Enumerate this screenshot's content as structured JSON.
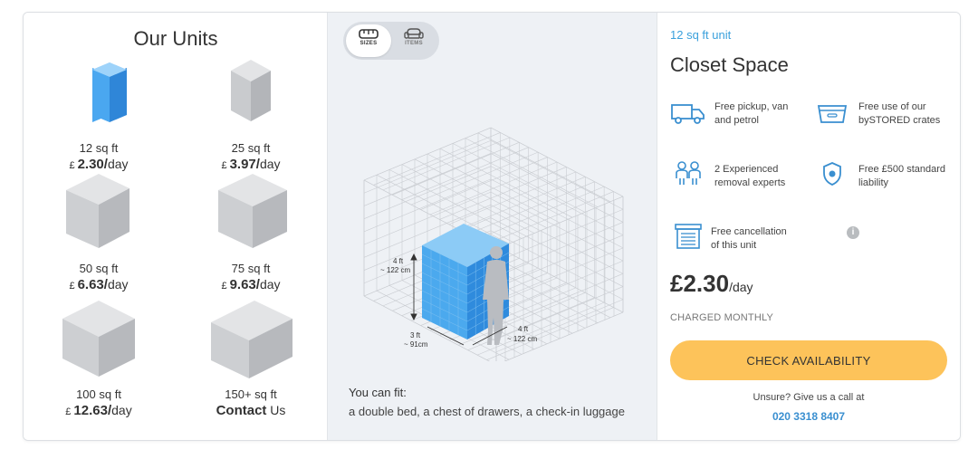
{
  "left": {
    "title": "Our Units",
    "units": [
      {
        "size": "12 sq ft",
        "currency": "£",
        "price": "2.30/",
        "per": "day",
        "selected": true
      },
      {
        "size": "25 sq ft",
        "currency": "£",
        "price": "3.97/",
        "per": "day"
      },
      {
        "size": "50 sq ft",
        "currency": "£",
        "price": "6.63/",
        "per": "day"
      },
      {
        "size": "75 sq ft",
        "currency": "£",
        "price": "9.63/",
        "per": "day"
      },
      {
        "size": "100 sq ft",
        "currency": "£",
        "price": "12.63/",
        "per": "day"
      },
      {
        "size": "150+ sq ft",
        "contact_bold": "Contact",
        "contact_rest": " Us"
      }
    ]
  },
  "middle": {
    "toggle": {
      "sizes_label": "SIZES",
      "items_label": "ITEMS",
      "active": "SIZES"
    },
    "dimensions": {
      "height_ft": "4 ft",
      "height_cm": "~ 122 cm",
      "width_ft": "3 ft",
      "width_cm": "~ 91cm",
      "depth_ft": "4 ft",
      "depth_cm": "~ 122 cm"
    },
    "fit_label": "You can fit:",
    "fit_items": "a double bed, a chest of drawers, a check-in luggage"
  },
  "right": {
    "unit_tag": "12 sq ft unit",
    "unit_name": "Closet Space",
    "features": [
      {
        "icon": "van-icon",
        "line1": "Free pickup, van",
        "line2": "and petrol"
      },
      {
        "icon": "crate-icon",
        "line1": "Free use of our",
        "line2": "bySTORED crates"
      },
      {
        "icon": "people-icon",
        "line1": "2 Experienced",
        "line2": "removal experts"
      },
      {
        "icon": "shield-icon",
        "line1": "Free £500 standard",
        "line2": "liability"
      },
      {
        "icon": "storage-door-icon",
        "line1": "Free cancellation",
        "line2": "of this unit"
      }
    ],
    "price": "£2.30",
    "price_per": "/day",
    "charged": "CHARGED MONTHLY",
    "cta": "CHECK AVAILABILITY",
    "unsure": "Unsure? Give us a call at",
    "phone": "020 3318 8407"
  },
  "colors": {
    "accent_blue": "#3aa0dc",
    "cta_yellow": "#fdc35a",
    "selected_box": "#3d9be9",
    "grey_box": "#c7c9cc"
  }
}
